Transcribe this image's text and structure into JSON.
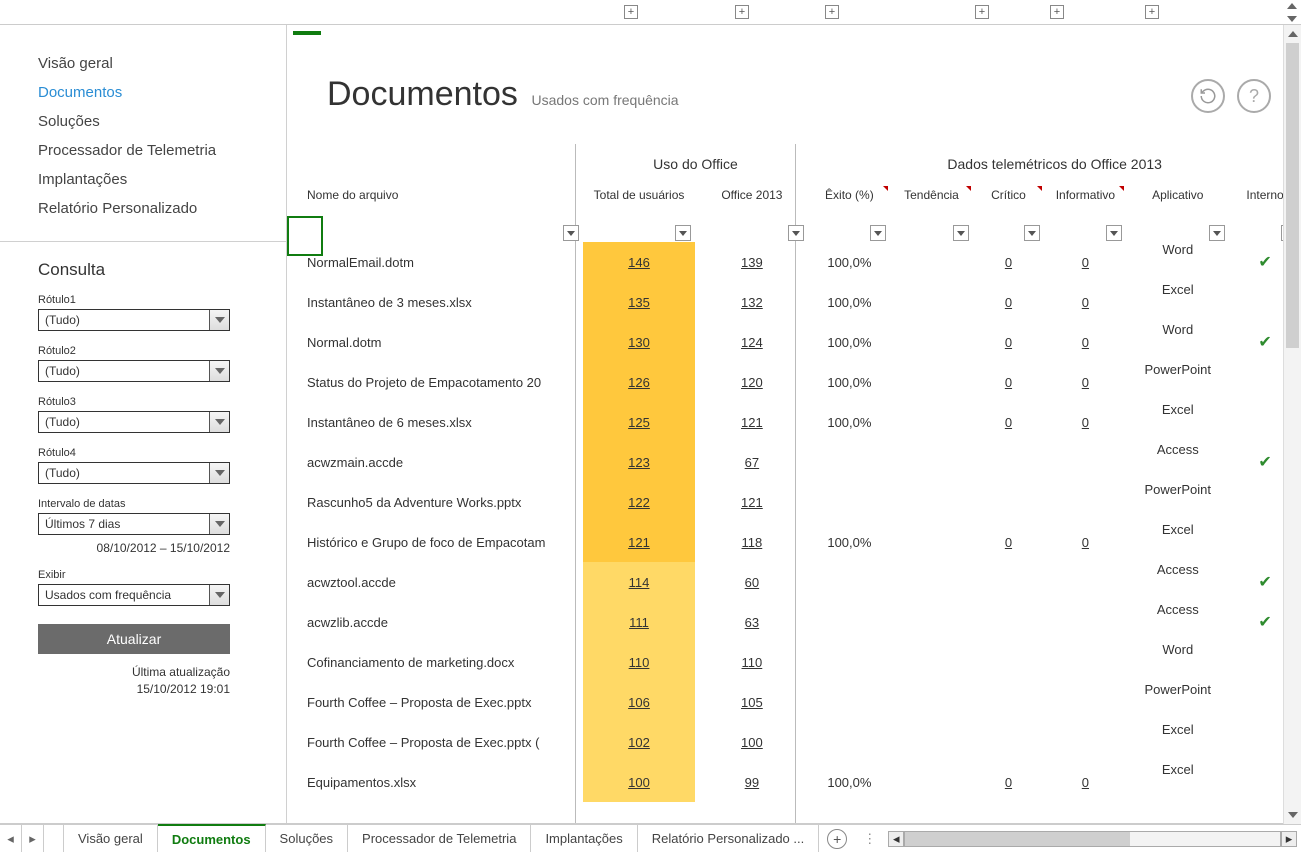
{
  "nav": {
    "items": [
      {
        "label": "Visão geral"
      },
      {
        "label": "Documentos"
      },
      {
        "label": "Soluções"
      },
      {
        "label": "Processador de Telemetria"
      },
      {
        "label": "Implantações"
      },
      {
        "label": "Relatório Personalizado"
      }
    ]
  },
  "consult": {
    "title": "Consulta",
    "labels": [
      "Rótulo1",
      "Rótulo2",
      "Rótulo3",
      "Rótulo4"
    ],
    "all": "(Tudo)",
    "date_label": "Intervalo de datas",
    "date_value": "Últimos 7 dias",
    "date_range": "08/10/2012 – 15/10/2012",
    "show_label": "Exibir",
    "show_value": "Usados com frequência",
    "update": "Atualizar",
    "last_update_label": "Última atualização",
    "last_update_value": "15/10/2012 19:01"
  },
  "main": {
    "title": "Documentos",
    "subtitle": "Usados com frequência"
  },
  "headers": {
    "group1": "Uso do Office",
    "group2": "Dados telemétricos do Office 2013",
    "name": "Nome do arquivo",
    "total": "Total de usuários",
    "office": "Office 2013",
    "success": "Êxito (%)",
    "trend": "Tendência",
    "critical": "Crítico",
    "info": "Informativo",
    "app": "Aplicativo",
    "internal": "Interno"
  },
  "rows": [
    {
      "name": "NormalEmail.dotm",
      "total": "146",
      "office": "139",
      "success": "100,0%",
      "critical": "0",
      "info": "0",
      "app": "Word",
      "check": true,
      "shade": "dark"
    },
    {
      "name": "Instantâneo de 3 meses.xlsx",
      "total": "135",
      "office": "132",
      "success": "100,0%",
      "critical": "0",
      "info": "0",
      "app": "Excel",
      "check": false,
      "shade": "dark"
    },
    {
      "name": "Normal.dotm",
      "total": "130",
      "office": "124",
      "success": "100,0%",
      "critical": "0",
      "info": "0",
      "app": "Word",
      "check": true,
      "shade": "dark"
    },
    {
      "name": "Status do Projeto de Empacotamento 20",
      "total": "126",
      "office": "120",
      "success": "100,0%",
      "critical": "0",
      "info": "0",
      "app": "PowerPoint",
      "check": false,
      "shade": "dark"
    },
    {
      "name": "Instantâneo de 6 meses.xlsx",
      "total": "125",
      "office": "121",
      "success": "100,0%",
      "critical": "0",
      "info": "0",
      "app": "Excel",
      "check": false,
      "shade": "dark"
    },
    {
      "name": "acwzmain.accde",
      "total": "123",
      "office": "67",
      "success": "",
      "critical": "",
      "info": "",
      "app": "Access",
      "check": true,
      "shade": "dark"
    },
    {
      "name": "Rascunho5 da Adventure Works.pptx",
      "total": "122",
      "office": "121",
      "success": "",
      "critical": "",
      "info": "",
      "app": "PowerPoint",
      "check": false,
      "shade": "dark"
    },
    {
      "name": "Histórico e Grupo de foco de Empacotam",
      "total": "121",
      "office": "118",
      "success": "100,0%",
      "critical": "0",
      "info": "0",
      "app": "Excel",
      "check": false,
      "shade": "dark"
    },
    {
      "name": "acwztool.accde",
      "total": "114",
      "office": "60",
      "success": "",
      "critical": "",
      "info": "",
      "app": "Access",
      "check": true,
      "shade": "light"
    },
    {
      "name": "acwzlib.accde",
      "total": "111",
      "office": "63",
      "success": "",
      "critical": "",
      "info": "",
      "app": "Access",
      "check": true,
      "shade": "light"
    },
    {
      "name": "Cofinanciamento de marketing.docx",
      "total": "110",
      "office": "110",
      "success": "",
      "critical": "",
      "info": "",
      "app": "Word",
      "check": false,
      "shade": "light"
    },
    {
      "name": "Fourth Coffee – Proposta de Exec.pptx",
      "total": "106",
      "office": "105",
      "success": "",
      "critical": "",
      "info": "",
      "app": "PowerPoint",
      "check": false,
      "shade": "light"
    },
    {
      "name": "Fourth Coffee – Proposta de Exec.pptx (",
      "total": "102",
      "office": "100",
      "success": "",
      "critical": "",
      "info": "",
      "app": "Excel",
      "check": false,
      "shade": "light"
    },
    {
      "name": "Equipamentos.xlsx",
      "total": "100",
      "office": "99",
      "success": "100,0%",
      "critical": "0",
      "info": "0",
      "app": "Excel",
      "check": false,
      "shade": "light"
    }
  ],
  "tabs": {
    "items": [
      "Visão geral",
      "Documentos",
      "Soluções",
      "Processador de Telemetria",
      "Implantações",
      "Relatório Personalizado ..."
    ]
  }
}
